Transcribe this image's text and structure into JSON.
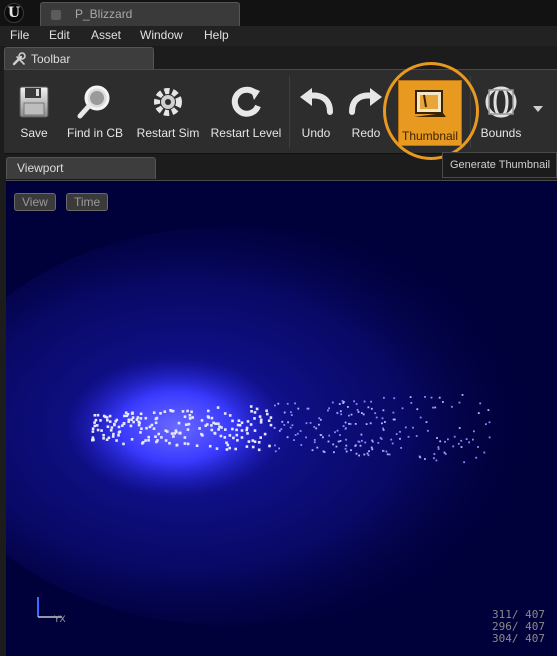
{
  "window": {
    "doc_tab_title": "P_Blizzard",
    "logo_letter": "U"
  },
  "menu": {
    "items": [
      "File",
      "Edit",
      "Asset",
      "Window",
      "Help"
    ]
  },
  "toolbar_tab": {
    "label": "Toolbar"
  },
  "toolbar": {
    "buttons": [
      {
        "label": "Save",
        "icon": "save-icon"
      },
      {
        "label": "Find in CB",
        "icon": "find-in-cb-icon"
      },
      {
        "label": "Restart Sim",
        "icon": "restart-sim-icon"
      },
      {
        "label": "Restart Level",
        "icon": "restart-level-icon"
      },
      {
        "label": "Undo",
        "icon": "undo-icon"
      },
      {
        "label": "Redo",
        "icon": "redo-icon"
      },
      {
        "label": "Thumbnail",
        "icon": "thumbnail-icon",
        "active": true
      },
      {
        "label": "Bounds",
        "icon": "bounds-icon"
      }
    ],
    "active_color": "#e89920"
  },
  "tooltip": {
    "text": "Generate Thumbnail"
  },
  "viewport_tab": {
    "label": "Viewport"
  },
  "viewport": {
    "view_button": "View",
    "time_button": "Time",
    "axis_label": "YX",
    "stats": [
      "311/ 407",
      "296/ 407",
      "304/ 407"
    ],
    "background_color": "#00003a",
    "glow_color": "#2a2aff"
  }
}
